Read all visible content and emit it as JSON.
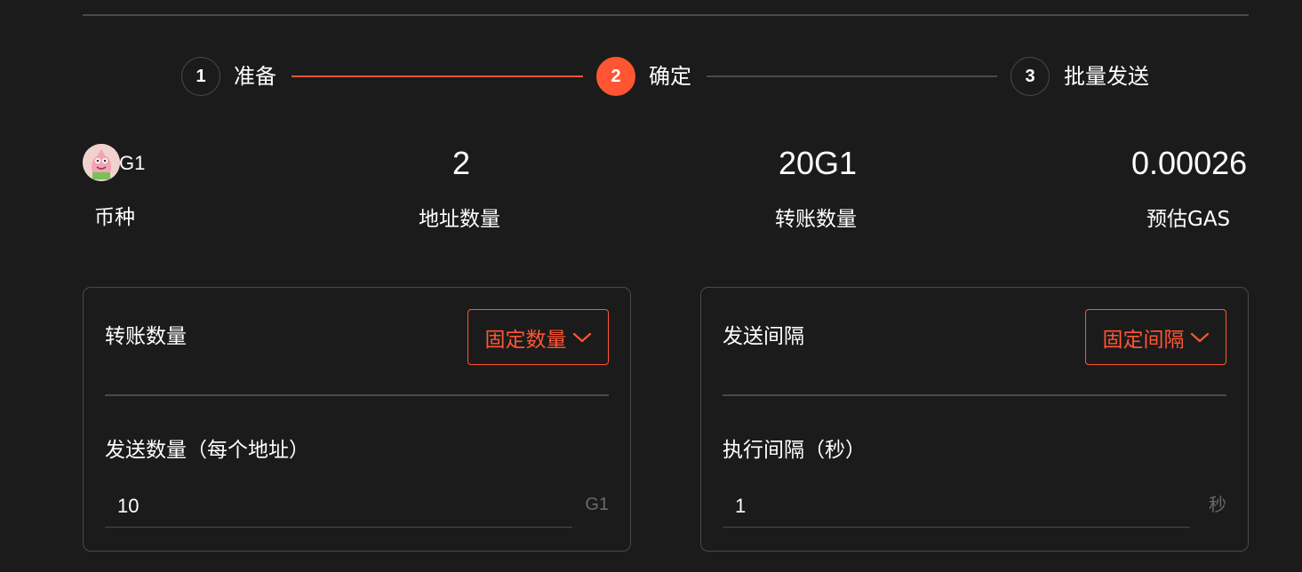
{
  "stepper": {
    "steps": [
      {
        "number": "1",
        "label": "准备",
        "state": "done"
      },
      {
        "number": "2",
        "label": "确定",
        "state": "active"
      },
      {
        "number": "3",
        "label": "批量发送",
        "state": "pending"
      }
    ],
    "accent_color": "#ff5533"
  },
  "summary": {
    "token": {
      "icon": "token-avatar-icon",
      "name": "G1",
      "label": "币种"
    },
    "address_count": {
      "value": "2",
      "label": "地址数量"
    },
    "transfer_amount": {
      "value": "20G1",
      "label": "转账数量"
    },
    "estimated_gas": {
      "value": "0.00026",
      "label": "预估GAS"
    }
  },
  "transfer_card": {
    "title": "转账数量",
    "mode_select": {
      "value": "固定数量",
      "icon": "chevron-down-icon"
    },
    "field": {
      "label": "发送数量（每个地址）",
      "value": "10",
      "unit": "G1"
    }
  },
  "interval_card": {
    "title": "发送间隔",
    "mode_select": {
      "value": "固定间隔",
      "icon": "chevron-down-icon"
    },
    "field": {
      "label": "执行间隔（秒）",
      "value": "1",
      "unit": "秒"
    }
  }
}
